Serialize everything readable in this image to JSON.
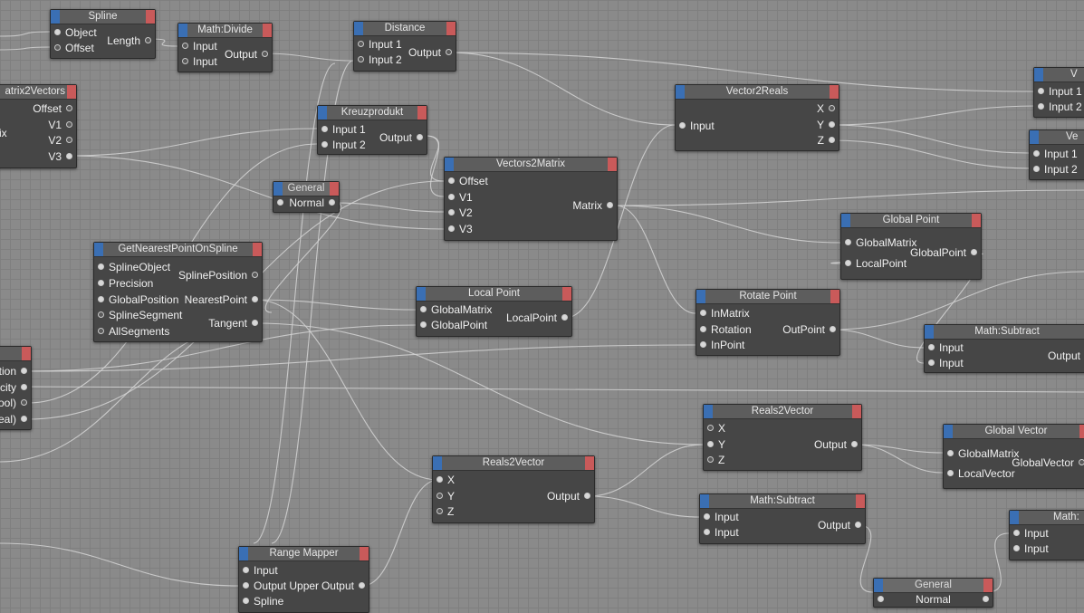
{
  "wire_color": "#d4d4d4",
  "nodes": {
    "spline": {
      "title": "Spline",
      "inputs": [
        "Object",
        "Offset"
      ],
      "outputs": [
        "Length"
      ]
    },
    "divide1": {
      "title": "Math:Divide",
      "inputs": [
        "Input",
        "Input"
      ],
      "outputs": [
        "Output"
      ]
    },
    "distance": {
      "title": "Distance",
      "inputs": [
        "Input 1",
        "Input 2"
      ],
      "outputs": [
        "Output"
      ]
    },
    "m2v": {
      "title": "atrix2Vectors",
      "left_label": "atrix",
      "outputs": [
        "Offset",
        "V1",
        "V2",
        "V3"
      ]
    },
    "kreuz": {
      "title": "Kreuzprodukt",
      "inputs": [
        "Input 1",
        "Input 2"
      ],
      "outputs": [
        "Output"
      ]
    },
    "v2r": {
      "title": "Vector2Reals",
      "inputs": [
        "Input"
      ],
      "outputs": [
        "X",
        "Y",
        "Z"
      ]
    },
    "vr1": {
      "title": "V",
      "inputs": [
        "Input 1",
        "Input 2"
      ]
    },
    "vr2": {
      "title": "Ve",
      "inputs": [
        "Input 1",
        "Input 2"
      ]
    },
    "gen1": {
      "title": "General",
      "outputs": [
        "Normal"
      ]
    },
    "v2m": {
      "title": "Vectors2Matrix",
      "inputs": [
        "Offset",
        "V1",
        "V2",
        "V3"
      ],
      "outputs": [
        "Matrix"
      ]
    },
    "gnp": {
      "title": "GetNearestPointOnSpline",
      "inputs": [
        "SplineObject",
        "Precision",
        "GlobalPosition",
        "SplineSegment",
        "AllSegments"
      ],
      "outputs": [
        "SplinePosition",
        "NearestPoint",
        "Tangent"
      ]
    },
    "gpoint": {
      "title": "Global Point",
      "inputs": [
        "GlobalMatrix",
        "LocalPoint"
      ],
      "outputs": [
        "GlobalPoint"
      ]
    },
    "lpoint": {
      "title": "Local Point",
      "inputs": [
        "GlobalMatrix",
        "GlobalPoint"
      ],
      "outputs": [
        "LocalPoint"
      ]
    },
    "rpoint": {
      "title": "Rotate Point",
      "inputs": [
        "InMatrix",
        "Rotation",
        "InPoint"
      ],
      "outputs": [
        "OutPoint"
      ]
    },
    "msub1": {
      "title": "Math:Subtract",
      "inputs": [
        "Input",
        "Input"
      ],
      "outputs": [
        "Output"
      ]
    },
    "leftnode": {
      "outputs": [
        "ation",
        "city",
        "ool)",
        "eal)"
      ]
    },
    "r2v1": {
      "title": "Reals2Vector",
      "inputs": [
        "X",
        "Y",
        "Z"
      ],
      "outputs": [
        "Output"
      ]
    },
    "gvec": {
      "title": "Global Vector",
      "inputs": [
        "GlobalMatrix",
        "LocalVector"
      ],
      "outputs": [
        "GlobalVector"
      ]
    },
    "r2v2": {
      "title": "Reals2Vector",
      "inputs": [
        "X",
        "Y",
        "Z"
      ],
      "outputs": [
        "Output"
      ]
    },
    "msub2": {
      "title": "Math:Subtract",
      "inputs": [
        "Input",
        "Input"
      ],
      "outputs": [
        "Output"
      ]
    },
    "mathr": {
      "title": "Math:",
      "inputs": [
        "Input",
        "Input"
      ]
    },
    "rmap": {
      "title": "Range Mapper",
      "inputs": [
        "Input",
        "Output Upper",
        "Spline"
      ],
      "outputs": [
        "Output"
      ]
    },
    "gen2": {
      "title": "General",
      "outputs": [
        "Normal"
      ]
    }
  }
}
